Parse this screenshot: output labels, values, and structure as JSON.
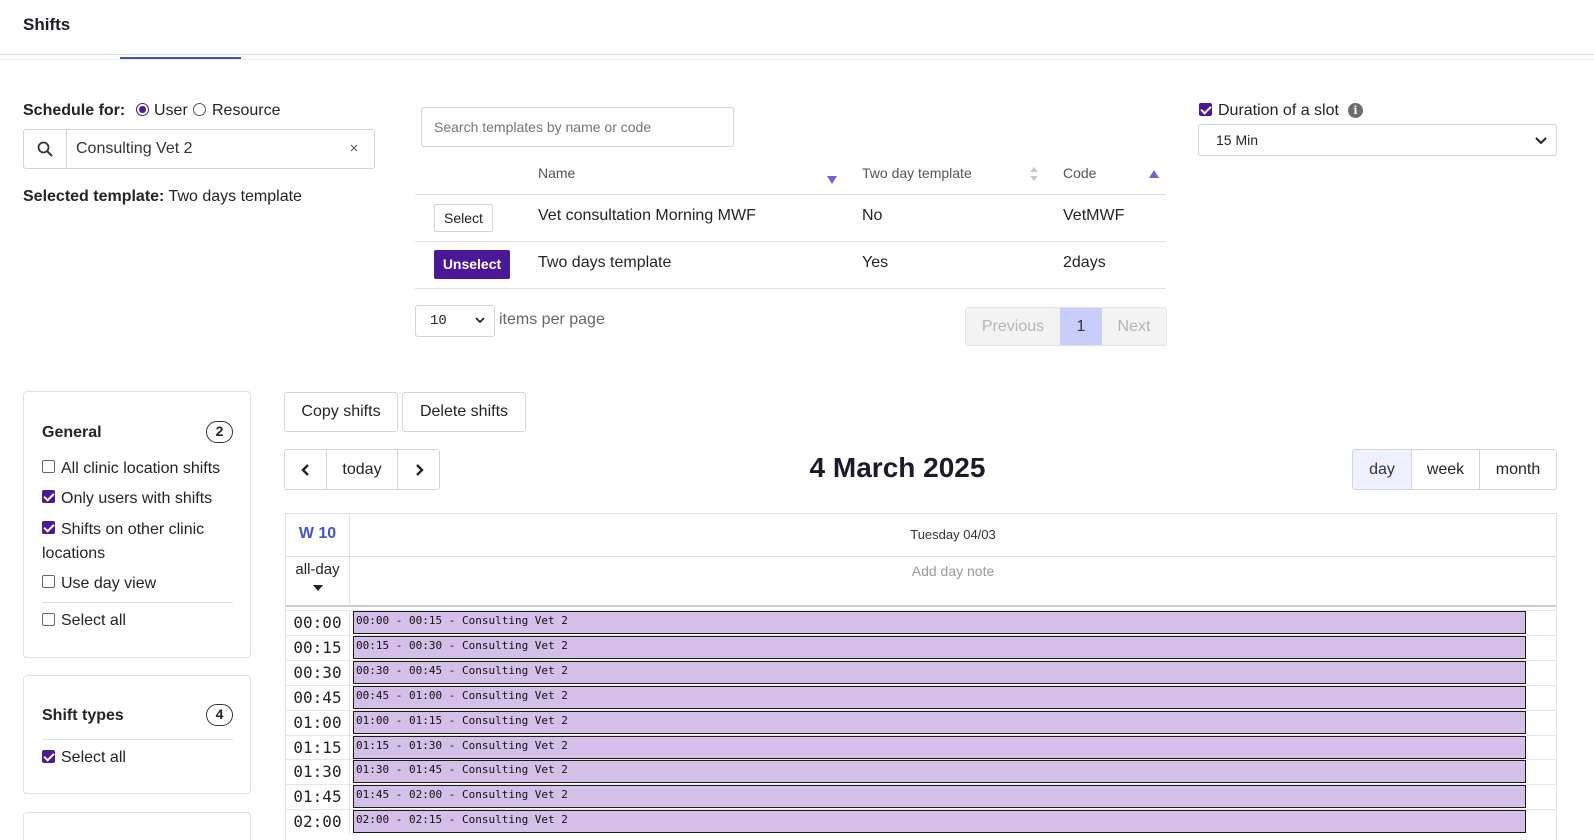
{
  "header": {
    "title": "Shifts"
  },
  "schedule": {
    "label": "Schedule for:",
    "option_user": "User",
    "option_resource": "Resource",
    "search_value": "Consulting Vet 2",
    "clear_symbol": "×",
    "selected_label": "Selected template:",
    "selected_value": "Two days template"
  },
  "templates": {
    "search_placeholder": "Search templates by name or code",
    "columns": {
      "name": "Name",
      "two_day": "Two day template",
      "code": "Code"
    },
    "rows": [
      {
        "action": "Select",
        "name": "Vet consultation Morning MWF",
        "two_day": "No",
        "code": "VetMWF"
      },
      {
        "action": "Unselect",
        "name": "Two days template",
        "two_day": "Yes",
        "code": "2days"
      }
    ],
    "items_per_page_value": "10",
    "items_per_page_label": "items per page",
    "pager": {
      "previous": "Previous",
      "page": "1",
      "next": "Next"
    }
  },
  "duration": {
    "label": "Duration of a slot",
    "info": "i",
    "value": "15 Min",
    "checked": true
  },
  "general_panel": {
    "title": "General",
    "count": "2",
    "options": [
      {
        "label": "All clinic location shifts",
        "checked": false
      },
      {
        "label": "Only users with shifts",
        "checked": true
      },
      {
        "label": "Shifts on other clinic locations",
        "checked": true
      },
      {
        "label": "Use day view",
        "checked": false
      }
    ],
    "select_all": "Select all"
  },
  "shift_types_panel": {
    "title": "Shift types",
    "count": "4",
    "select_all": "Select all"
  },
  "calendar": {
    "copy_shifts": "Copy shifts",
    "delete_shifts": "Delete shifts",
    "today": "today",
    "title": "4 March 2025",
    "views": {
      "day": "day",
      "week": "week",
      "month": "month"
    },
    "week_label": "W 10",
    "day_header": "Tuesday 04/03",
    "all_day": "all-day",
    "day_note": "Add day note",
    "times": [
      "00:00",
      "00:15",
      "00:30",
      "00:45",
      "01:00",
      "01:15",
      "01:30",
      "01:45",
      "02:00"
    ],
    "events": [
      "00:00 - 00:15 - Consulting Vet 2",
      "00:15 - 00:30 - Consulting Vet 2",
      "00:30 - 00:45 - Consulting Vet 2",
      "00:45 - 01:00 - Consulting Vet 2",
      "01:00 - 01:15 - Consulting Vet 2",
      "01:15 - 01:30 - Consulting Vet 2",
      "01:30 - 01:45 - Consulting Vet 2",
      "01:45 - 02:00 - Consulting Vet 2",
      "02:00 - 02:15 - Consulting Vet 2"
    ],
    "event_color": "#d3bfe8"
  },
  "colors": {
    "accent": "#4b1897",
    "link": "#4553c9"
  }
}
